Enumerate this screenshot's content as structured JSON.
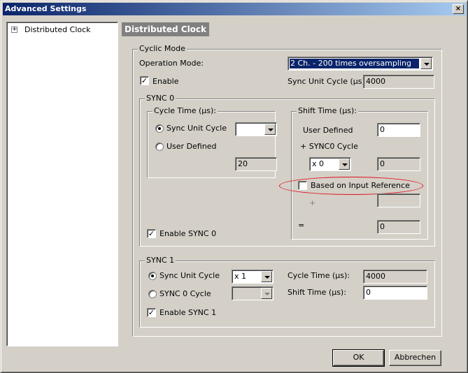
{
  "window": {
    "title": "Advanced Settings",
    "close_glyph": "×"
  },
  "tree": {
    "items": [
      {
        "label": "Distributed Clock",
        "expander": "+"
      }
    ]
  },
  "page_title": "Distributed Clock",
  "cyclic_mode": {
    "group_label": "Cyclic Mode",
    "operation_mode_label": "Operation Mode:",
    "operation_mode_value": "2 Ch. - 200 times oversampling",
    "enable_label": "Enable",
    "enable_checked": true,
    "sync_unit_cycle_label": "Sync Unit Cycle (µs):",
    "sync_unit_cycle_value": "4000"
  },
  "sync0": {
    "group_label": "SYNC 0",
    "cycle_time": {
      "group_label": "Cycle Time (µs):",
      "sync_unit_cycle_label": "Sync Unit Cycle",
      "sync_unit_cycle_selected": true,
      "combo_value": "",
      "user_defined_label": "User Defined",
      "value": "20"
    },
    "shift_time": {
      "group_label": "Shift Time (µs):",
      "user_defined_label": "User Defined",
      "user_defined_value": "0",
      "sync0_cycle_label": "+ SYNC0 Cycle",
      "multiplier_value": "x 0",
      "multiplier_result": "0",
      "based_on_input_label": "Based on Input Reference",
      "based_on_input_checked": false,
      "plus_label": "+",
      "plus_value": "",
      "equals_label": "=",
      "result_value": "0"
    },
    "enable_label": "Enable SYNC 0",
    "enable_checked": true
  },
  "sync1": {
    "group_label": "SYNC 1",
    "sync_unit_cycle_label": "Sync Unit Cycle",
    "sync_unit_cycle_selected": true,
    "multiplier_value": "x 1",
    "sync0_cycle_label": "SYNC 0 Cycle",
    "sync0_combo_value": "",
    "cycle_time_label": "Cycle Time (µs):",
    "cycle_time_value": "4000",
    "shift_time_label": "Shift Time (µs):",
    "shift_time_value": "0",
    "enable_label": "Enable SYNC 1",
    "enable_checked": true
  },
  "buttons": {
    "ok": "OK",
    "cancel": "Abbrechen"
  },
  "check_glyph": "✓",
  "colors": {
    "title_start": "#0a246a",
    "title_end": "#a6caf0",
    "face": "#d4d0c8",
    "highlight_ellipse": "#e0101a"
  }
}
